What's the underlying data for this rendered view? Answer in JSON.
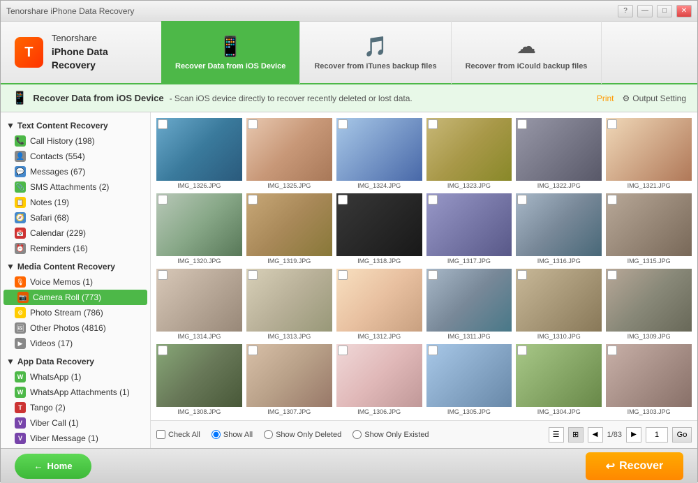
{
  "titleBar": {
    "appName": "Tenorshare",
    "appSubtitle": "iPhone Data Recovery",
    "btnMinimize": "—",
    "btnMaximize": "□",
    "btnClose": "✕"
  },
  "nav": {
    "tabs": [
      {
        "id": "ios",
        "icon": "📱",
        "label": "Recover Data from iOS Device",
        "active": true
      },
      {
        "id": "itunes",
        "icon": "🎵",
        "label": "Recover from iTunes backup files",
        "active": false
      },
      {
        "id": "icloud",
        "icon": "☁",
        "label": "Recover from iCould backup files",
        "active": false
      }
    ]
  },
  "subheader": {
    "icon": "📱",
    "title": "Recover Data from iOS Device",
    "description": "- Scan iOS device directly to recover recently deleted or lost data.",
    "printLabel": "Print",
    "outputLabel": "Output Setting"
  },
  "sidebar": {
    "sections": [
      {
        "id": "text-content",
        "label": "Text Content Recovery",
        "items": [
          {
            "id": "call-history",
            "icon": "📞",
            "iconClass": "icon-green",
            "label": "Call History (198)"
          },
          {
            "id": "contacts",
            "icon": "👤",
            "iconClass": "icon-gray",
            "label": "Contacts (554)"
          },
          {
            "id": "messages",
            "icon": "💬",
            "iconClass": "icon-blue",
            "label": "Messages (67)"
          },
          {
            "id": "sms-attachments",
            "icon": "📎",
            "iconClass": "icon-green",
            "label": "SMS Attachments (2)"
          },
          {
            "id": "notes",
            "icon": "📝",
            "iconClass": "icon-yellow",
            "label": "Notes (19)"
          },
          {
            "id": "safari",
            "icon": "🧭",
            "iconClass": "icon-blue",
            "label": "Safari (68)"
          },
          {
            "id": "calendar",
            "icon": "📅",
            "iconClass": "icon-red",
            "label": "Calendar (229)"
          },
          {
            "id": "reminders",
            "icon": "⏰",
            "iconClass": "icon-gray",
            "label": "Reminders (16)"
          }
        ]
      },
      {
        "id": "media-content",
        "label": "Media Content Recovery",
        "items": [
          {
            "id": "voice-memos",
            "icon": "🎙",
            "iconClass": "icon-orange",
            "label": "Voice Memos (1)"
          },
          {
            "id": "camera-roll",
            "icon": "📷",
            "iconClass": "icon-orange",
            "label": "Camera Roll (773)",
            "active": true
          },
          {
            "id": "photo-stream",
            "icon": "⚙",
            "iconClass": "icon-yellow",
            "label": "Photo Stream (786)"
          },
          {
            "id": "other-photos",
            "icon": "🖼",
            "iconClass": "icon-gray",
            "label": "Other Photos (4816)"
          },
          {
            "id": "videos",
            "icon": "▶",
            "iconClass": "icon-gray",
            "label": "Videos (17)"
          }
        ]
      },
      {
        "id": "app-data",
        "label": "App Data Recovery",
        "items": [
          {
            "id": "whatsapp",
            "icon": "W",
            "iconClass": "icon-green",
            "label": "WhatsApp (1)"
          },
          {
            "id": "whatsapp-attach",
            "icon": "W",
            "iconClass": "icon-green",
            "label": "WhatsApp Attachments (1)"
          },
          {
            "id": "tango",
            "icon": "T",
            "iconClass": "icon-red",
            "label": "Tango (2)"
          },
          {
            "id": "viber-call",
            "icon": "V",
            "iconClass": "icon-purple",
            "label": "Viber Call (1)"
          },
          {
            "id": "viber-message",
            "icon": "V",
            "iconClass": "icon-purple",
            "label": "Viber Message (1)"
          }
        ]
      }
    ]
  },
  "photos": [
    {
      "id": "p1",
      "name": "IMG_1326.JPG",
      "colorClass": "p1"
    },
    {
      "id": "p2",
      "name": "IMG_1325.JPG",
      "colorClass": "p2"
    },
    {
      "id": "p3",
      "name": "IMG_1324.JPG",
      "colorClass": "p3"
    },
    {
      "id": "p4",
      "name": "IMG_1323.JPG",
      "colorClass": "p4"
    },
    {
      "id": "p5",
      "name": "IMG_1322.JPG",
      "colorClass": "p5"
    },
    {
      "id": "p6",
      "name": "IMG_1321.JPG",
      "colorClass": "p6"
    },
    {
      "id": "p7",
      "name": "IMG_1320.JPG",
      "colorClass": "p7"
    },
    {
      "id": "p8",
      "name": "IMG_1319.JPG",
      "colorClass": "p8"
    },
    {
      "id": "p9",
      "name": "IMG_1318.JPG",
      "colorClass": "p9"
    },
    {
      "id": "p10",
      "name": "IMG_1317.JPG",
      "colorClass": "p10"
    },
    {
      "id": "p11",
      "name": "IMG_1316.JPG",
      "colorClass": "p11"
    },
    {
      "id": "p12",
      "name": "IMG_1315.JPG",
      "colorClass": "p12"
    },
    {
      "id": "p13",
      "name": "IMG_1314.JPG",
      "colorClass": "p2"
    },
    {
      "id": "p14",
      "name": "IMG_1313.JPG",
      "colorClass": "p5"
    },
    {
      "id": "p15",
      "name": "IMG_1312.JPG",
      "colorClass": "p3"
    },
    {
      "id": "p16",
      "name": "IMG_1311.JPG",
      "colorClass": "p7"
    },
    {
      "id": "p17",
      "name": "IMG_1310.JPG",
      "colorClass": "p9"
    },
    {
      "id": "p18",
      "name": "IMG_1309.JPG",
      "colorClass": "p6"
    },
    {
      "id": "p19",
      "name": "IMG_1308.JPG",
      "colorClass": "p10"
    },
    {
      "id": "p20",
      "name": "IMG_1307.JPG",
      "colorClass": "p4"
    },
    {
      "id": "p21",
      "name": "IMG_1306.JPG",
      "colorClass": "p1"
    },
    {
      "id": "p22",
      "name": "IMG_1305.JPG",
      "colorClass": "p8"
    },
    {
      "id": "p23",
      "name": "IMG_1304.JPG",
      "colorClass": "p11"
    },
    {
      "id": "p24",
      "name": "IMG_1303.JPG",
      "colorClass": "p12"
    }
  ],
  "toolbar": {
    "checkAllLabel": "Check All",
    "showAllLabel": "Show All",
    "showDeletedLabel": "Show Only Deleted",
    "showExistedLabel": "Show Only Existed",
    "pageInfo": "1/83",
    "pageNum": "1",
    "goLabel": "Go"
  },
  "bottomBar": {
    "homeLabel": "Home",
    "recoverLabel": "Recover"
  }
}
